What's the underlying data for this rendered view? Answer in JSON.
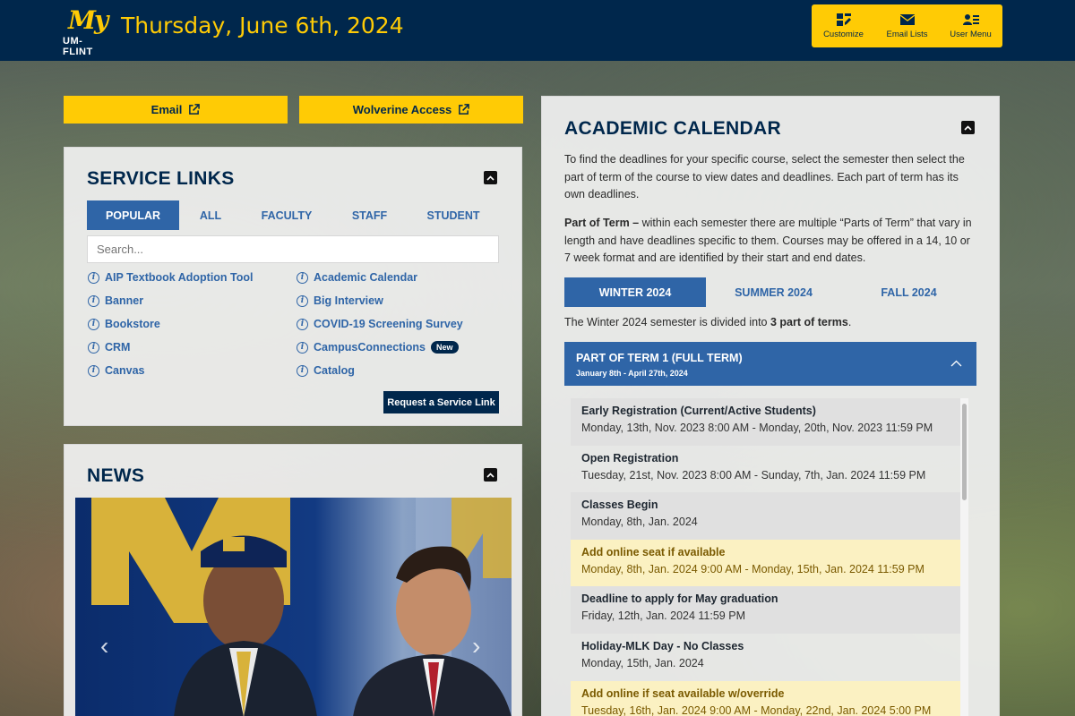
{
  "header": {
    "logo_top": "My",
    "logo_bottom": "UM-FLINT",
    "date": "Thursday, June 6th, 2024",
    "tools": [
      {
        "label": "Customize",
        "icon": "customize-icon"
      },
      {
        "label": "Email Lists",
        "icon": "envelope-icon"
      },
      {
        "label": "User Menu",
        "icon": "user-menu-icon"
      }
    ]
  },
  "quick_links": {
    "email": "Email",
    "wolverine": "Wolverine Access"
  },
  "service_links": {
    "title": "SERVICE LINKS",
    "tabs": [
      "POPULAR",
      "ALL",
      "FACULTY",
      "STAFF",
      "STUDENT"
    ],
    "search_placeholder": "Search...",
    "left": [
      "AIP Textbook Adoption Tool",
      "Banner",
      "Bookstore",
      "CRM",
      "Canvas"
    ],
    "right": [
      "Academic Calendar",
      "Big Interview",
      "COVID-19 Screening Survey",
      "CampusConnections",
      "Catalog"
    ],
    "new_badge": "New",
    "request_button": "Request a Service Link",
    "info_glyph": "i"
  },
  "news": {
    "title": "NEWS",
    "prev": "‹",
    "next": "›"
  },
  "calendar": {
    "title": "ACADEMIC CALENDAR",
    "intro": "To find the deadlines for your specific course, select the semester then select the part of term of the course to view dates and deadlines. Each part of term has its own deadlines.",
    "part_label": "Part of Term –",
    "part_text": " within each semester there are multiple “Parts of Term” that vary in length and have deadlines specific to them. Courses may be offered in a 14, 10 or 7 week format and are identified by their start and end dates.",
    "tabs": [
      "WINTER 2024",
      "SUMMER 2024",
      "FALL 2024"
    ],
    "divided_prefix": "The Winter 2024 semester is divided into ",
    "divided_bold": "3 part of terms",
    "divided_suffix": ".",
    "term_title": "PART OF TERM 1 (FULL TERM)",
    "term_dates": "January 8th - April 27th, 2024",
    "events": [
      {
        "name": "Early Registration (Current/Active Students)",
        "when": "Monday, 13th, Nov. 2023 8:00 AM - Monday, 20th, Nov. 2023 11:59 PM",
        "style": "grey"
      },
      {
        "name": "Open Registration",
        "when": "Tuesday, 21st, Nov. 2023 8:00 AM - Sunday, 7th, Jan. 2024 11:59 PM",
        "style": "white"
      },
      {
        "name": "Classes Begin",
        "when": "Monday, 8th, Jan. 2024",
        "style": "grey"
      },
      {
        "name": "Add online seat if available",
        "when": "Monday, 8th, Jan. 2024 9:00 AM - Monday, 15th, Jan. 2024 11:59 PM",
        "style": "hi"
      },
      {
        "name": "Deadline to apply for May graduation",
        "when": "Friday, 12th, Jan. 2024 11:59 PM",
        "style": "grey"
      },
      {
        "name": "Holiday-MLK Day - No Classes",
        "when": "Monday, 15th, Jan. 2024",
        "style": "white"
      },
      {
        "name": "Add online if seat available w/override",
        "when": "Tuesday, 16th, Jan. 2024 9:00 AM - Monday, 22nd, Jan. 2024 5:00 PM",
        "style": "hi"
      }
    ]
  },
  "colors": {
    "navy": "#00274c",
    "maize": "#ffcb05",
    "blue": "#2f65a7"
  }
}
